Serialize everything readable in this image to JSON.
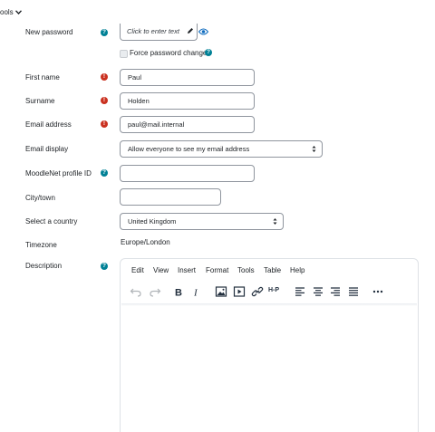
{
  "top_menu": {
    "label": "ools"
  },
  "fields": {
    "new_password": {
      "label": "New password",
      "placeholder": "Click to enter text"
    },
    "force_password_change": {
      "label": "Force password change"
    },
    "first_name": {
      "label": "First name",
      "value": "Paul"
    },
    "surname": {
      "label": "Surname",
      "value": "Holden"
    },
    "email": {
      "label": "Email address",
      "value": "paul@mail.internal"
    },
    "email_display": {
      "label": "Email display",
      "value": "Allow everyone to see my email address"
    },
    "moodlenet": {
      "label": "MoodleNet profile ID",
      "value": ""
    },
    "city": {
      "label": "City/town",
      "value": ""
    },
    "country": {
      "label": "Select a country",
      "value": "United Kingdom"
    },
    "timezone": {
      "label": "Timezone",
      "value": "Europe/London"
    },
    "description": {
      "label": "Description"
    }
  },
  "editor": {
    "menu": [
      "Edit",
      "View",
      "Insert",
      "Format",
      "Tools",
      "Table",
      "Help"
    ],
    "toolbar": [
      "undo-icon",
      "redo-icon",
      "bold-icon",
      "italic-icon",
      "image-icon",
      "media-icon",
      "link-icon",
      "h5p-icon",
      "align-left-icon",
      "align-center-icon",
      "align-right-icon",
      "align-justify-icon",
      "more-icon"
    ],
    "h5p_label": "H-P"
  },
  "colors": {
    "help": "#008196",
    "required": "#ca3120",
    "border": "#8f959e",
    "eye": "#0f6cbf"
  }
}
